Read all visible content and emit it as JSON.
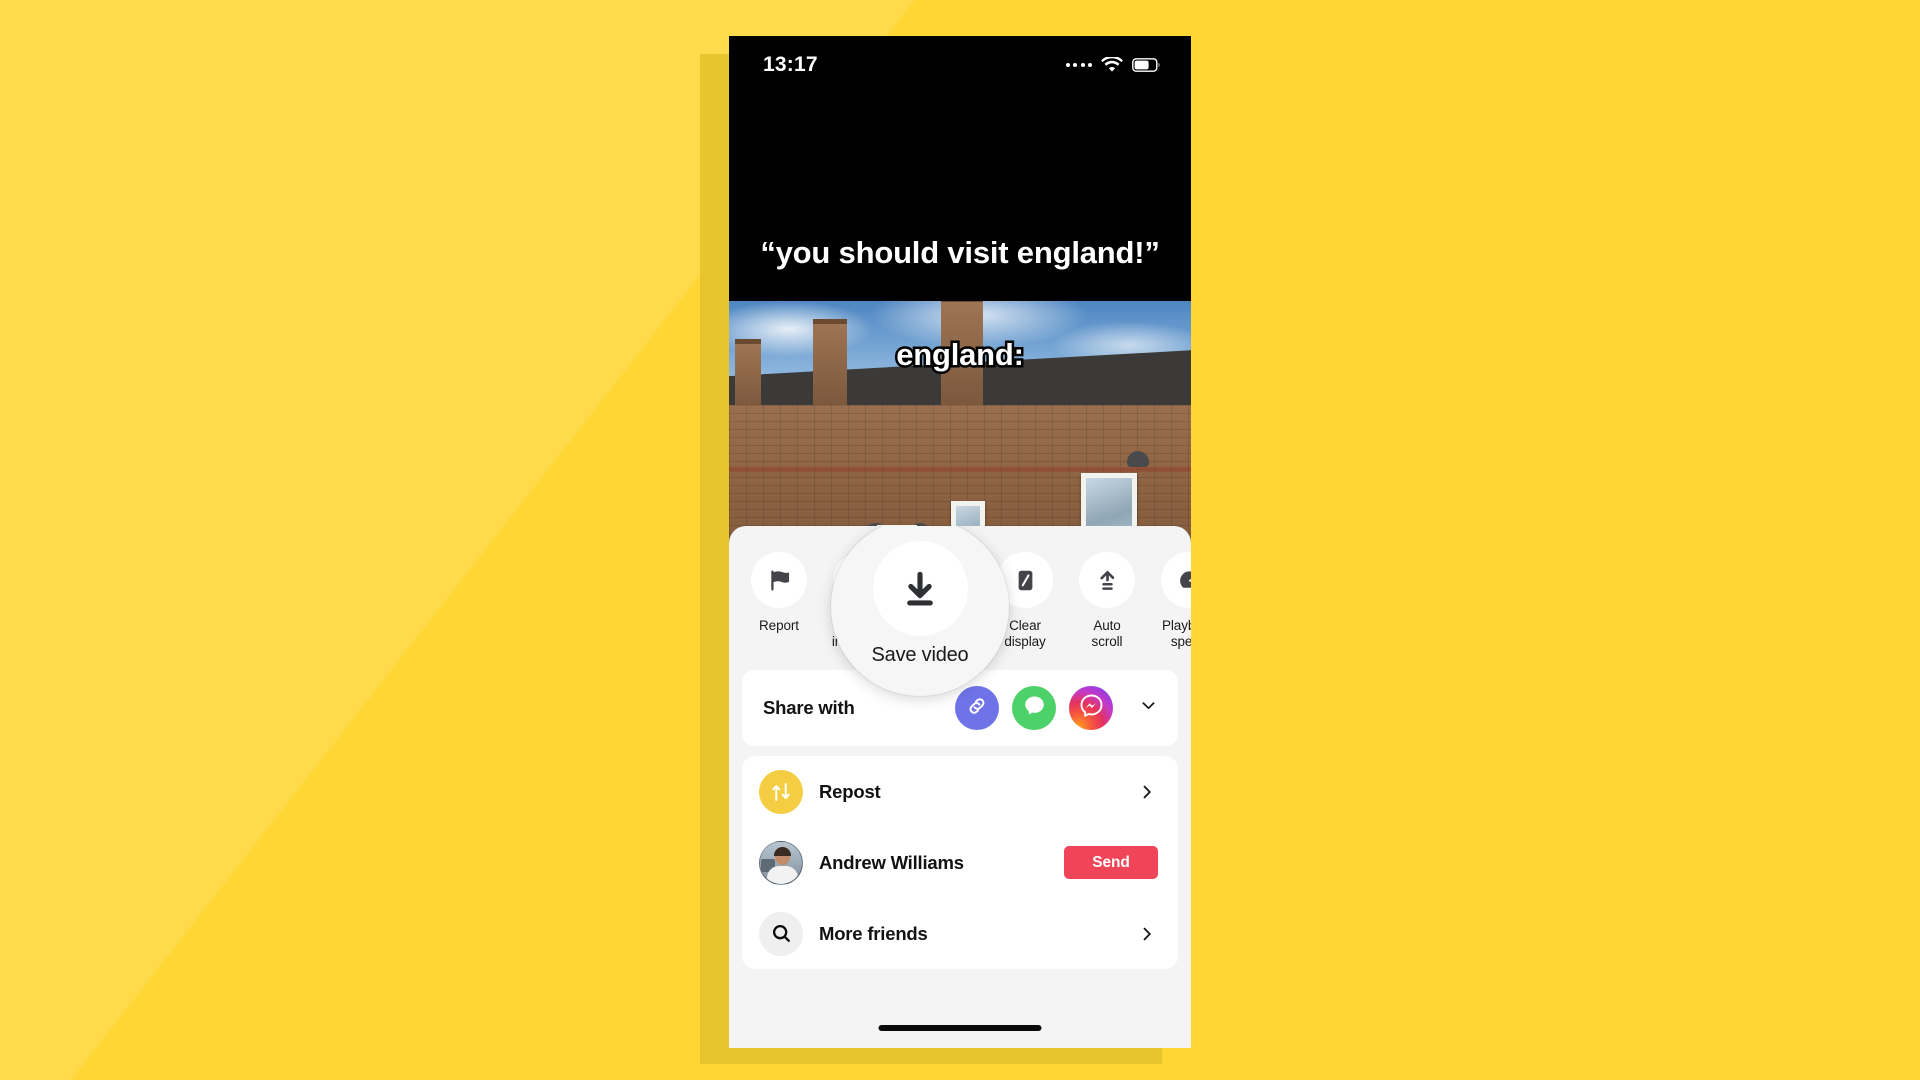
{
  "theme": {
    "background_color": "#FFD633",
    "phone_shadow_color": "#E8C52E",
    "sheet_background": "#F4F4F5",
    "card_background": "#FFFFFF",
    "send_button_color": "#F04458",
    "repost_icon_color": "#F5CD42",
    "copy_link_color": "#6E74E8",
    "sms_color": "#4CD269",
    "action_icon_color": "#43454A"
  },
  "status_bar": {
    "time": "13:17",
    "signal_icon": "signal-dots-icon",
    "wifi_icon": "wifi-icon",
    "battery_icon": "battery-icon"
  },
  "video": {
    "caption_line_1": "“you should visit\nengland!”",
    "caption_line_2": "england:"
  },
  "sheet": {
    "actions": [
      {
        "label": "Report",
        "icon": "flag-icon"
      },
      {
        "label": "Not\ninterested",
        "icon": "heart-broken-icon"
      },
      {
        "label": "Save video",
        "icon": "download-icon"
      },
      {
        "label": "Clear\ndisplay",
        "icon": "clear-display-icon"
      },
      {
        "label": "Auto scroll",
        "icon": "auto-scroll-icon"
      },
      {
        "label": "Playback\nspeed",
        "icon": "speedometer-icon"
      }
    ],
    "magnifier": {
      "label": "Save video",
      "icon": "download-icon"
    },
    "share": {
      "label": "Share with",
      "targets": [
        {
          "name": "Copy link",
          "icon": "link-icon"
        },
        {
          "name": "Messages",
          "icon": "message-bubble-icon"
        },
        {
          "name": "Messenger",
          "icon": "messenger-icon"
        }
      ],
      "expand_icon": "chevron-down-icon"
    },
    "list": [
      {
        "label": "Repost",
        "icon": "repost-icon",
        "accessory": "chevron-right-icon"
      },
      {
        "label": "Andrew Williams",
        "icon": "avatar",
        "accessory": "send-button",
        "send_label": "Send"
      },
      {
        "label": "More friends",
        "icon": "search-icon",
        "accessory": "chevron-right-icon"
      }
    ]
  },
  "home_indicator": "home-indicator"
}
